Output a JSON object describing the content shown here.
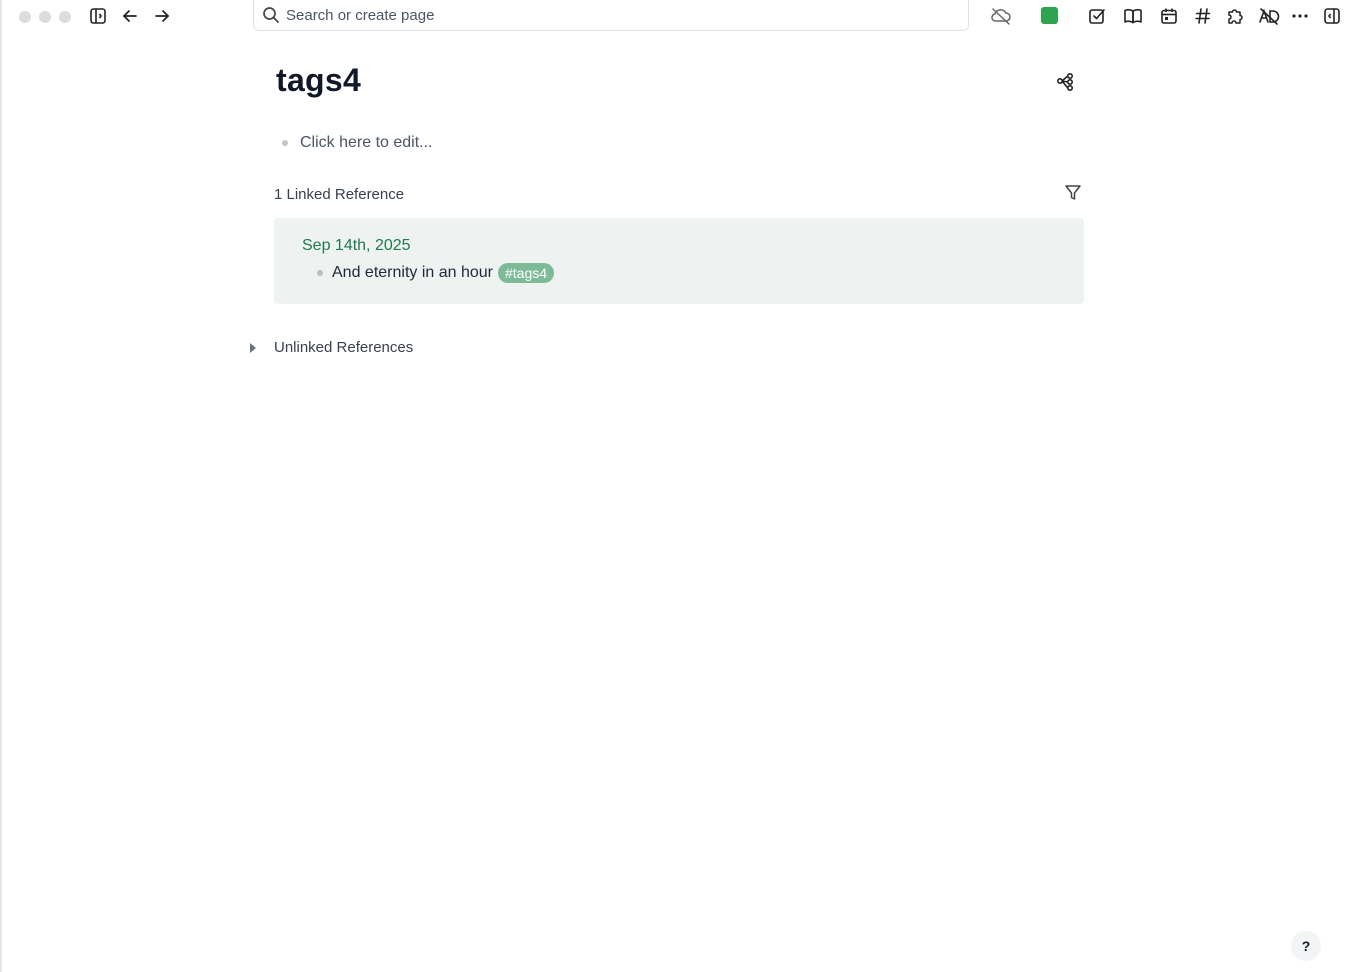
{
  "search": {
    "placeholder": "Search or create page"
  },
  "page": {
    "title": "tags4",
    "empty_block": "Click here to edit..."
  },
  "linked_refs": {
    "heading": "1 Linked Reference",
    "items": [
      {
        "date": "Sep 14th, 2025",
        "text": "And eternity in an hour",
        "tag": "#tags4"
      }
    ]
  },
  "unlinked_refs": {
    "heading": "Unlinked References"
  },
  "help": {
    "label": "?"
  },
  "colors": {
    "accent_green": "#2ea44f",
    "date_link": "#1f7a4d",
    "tag_bg": "#7dbb98",
    "card_bg": "#eef2f0"
  },
  "icons": [
    "sidebar-toggle-icon",
    "back-arrow-icon",
    "forward-arrow-icon",
    "search-icon",
    "cloud-off-icon",
    "checkbox-icon",
    "book-icon",
    "calendar-icon",
    "hashtag-icon",
    "puzzle-icon",
    "no-ads-icon",
    "more-icon",
    "right-sidebar-icon",
    "graph-icon",
    "filter-icon"
  ]
}
